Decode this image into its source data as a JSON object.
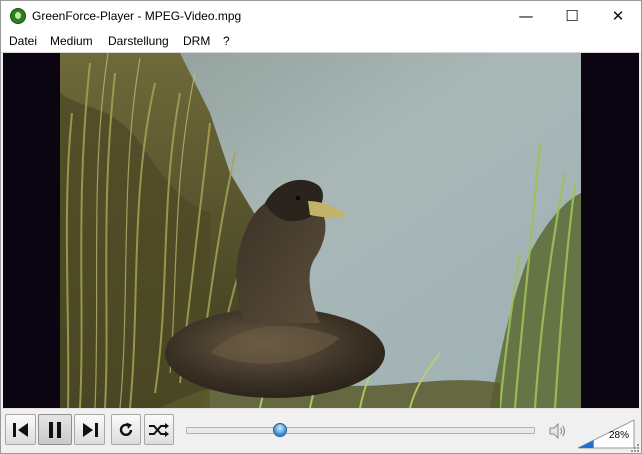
{
  "window": {
    "title": "GreenForce-Player - MPEG-Video.mpg",
    "controls": {
      "minimize": "—",
      "maximize": "☐",
      "close": "✕"
    }
  },
  "menu": {
    "items": [
      {
        "label": "Datei"
      },
      {
        "label": "Medium"
      },
      {
        "label": "Darstellung"
      },
      {
        "label": "DRM"
      },
      {
        "label": "?"
      }
    ]
  },
  "playback": {
    "state": "playing",
    "position_fraction": 0.27
  },
  "volume": {
    "label": "28%",
    "level_fraction": 0.28
  },
  "icons": {
    "app": "greenforce-player-icon",
    "prev": "previous-frame-icon",
    "pause": "pause-icon",
    "next": "next-frame-icon",
    "repeat": "repeat-icon",
    "shuffle": "shuffle-icon",
    "speaker": "speaker-icon"
  },
  "colors": {
    "seek_thumb": "#4b9be0",
    "volume_fill": "#1f73d0",
    "video_letterbox": "#0b0411"
  }
}
